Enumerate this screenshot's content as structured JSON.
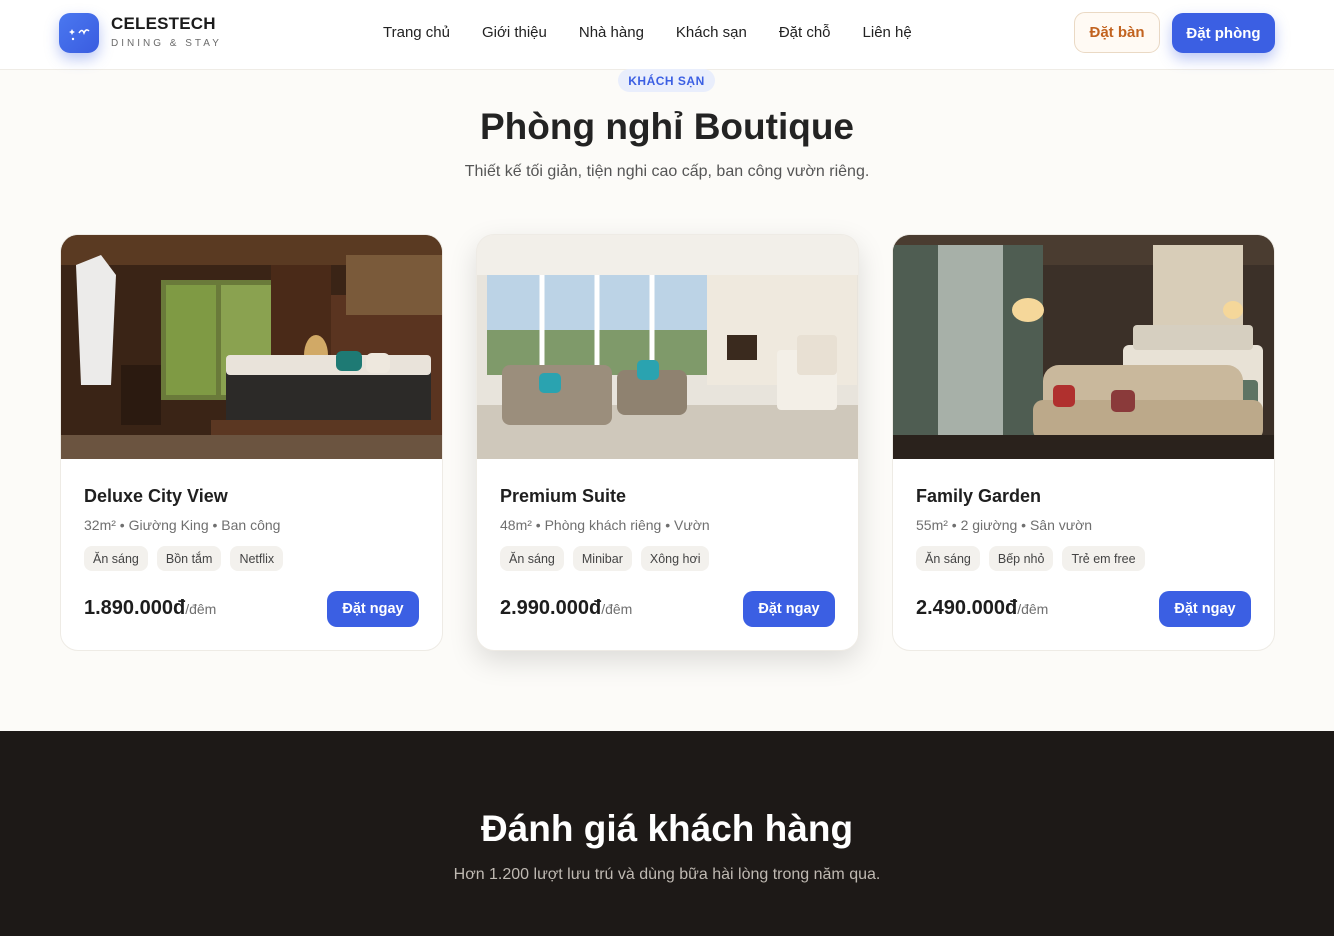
{
  "brand": {
    "name": "CELESTECH",
    "tagline": "DINING & STAY"
  },
  "nav": [
    "Trang chủ",
    "Giới thiệu",
    "Nhà hàng",
    "Khách sạn",
    "Đặt chỗ",
    "Liên hệ"
  ],
  "header_buttons": {
    "book_table": "Đặt bàn",
    "book_room": "Đặt phòng"
  },
  "section": {
    "tag": "KHÁCH SẠN",
    "title": "Phòng nghỉ Boutique",
    "subtitle": "Thiết kế tối giản, tiện nghi cao cấp, ban công vườn riêng."
  },
  "rooms": [
    {
      "name": "Deluxe City View",
      "meta": "32m² • Giường King • Ban công",
      "tags": [
        "Ăn sáng",
        "Bồn tắm",
        "Netflix"
      ],
      "price": "1.890.000đ",
      "unit": "/đêm",
      "button": "Đặt ngay"
    },
    {
      "name": "Premium Suite",
      "meta": "48m² • Phòng khách riêng • Vườn",
      "tags": [
        "Ăn sáng",
        "Minibar",
        "Xông hơi"
      ],
      "price": "2.990.000đ",
      "unit": "/đêm",
      "button": "Đặt ngay"
    },
    {
      "name": "Family Garden",
      "meta": "55m² • 2 giường • Sân vườn",
      "tags": [
        "Ăn sáng",
        "Bếp nhỏ",
        "Trẻ em free"
      ],
      "price": "2.490.000đ",
      "unit": "/đêm",
      "button": "Đặt ngay"
    }
  ],
  "reviews": {
    "title": "Đánh giá khách hàng",
    "subtitle": "Hơn 1.200 lượt lưu trú và dùng bữa hài lòng trong năm qua."
  },
  "colors": {
    "accent": "#3b5fe3",
    "table_button_text": "#c26320",
    "dark_bg": "#1d1917"
  }
}
